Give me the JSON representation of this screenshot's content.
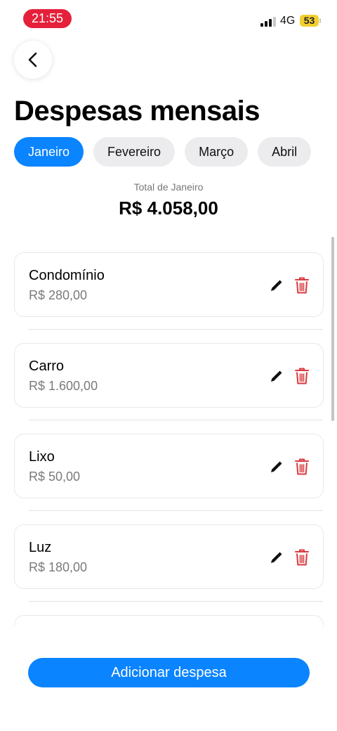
{
  "status_bar": {
    "time": "21:55",
    "network": "4G",
    "battery": "53",
    "battery_color": "#f2cf2e",
    "time_pill_color": "#e5203a"
  },
  "header": {
    "back_icon": "chevron-left-icon",
    "title": "Despesas mensais"
  },
  "months": [
    {
      "label": "Janeiro",
      "active": true
    },
    {
      "label": "Fevereiro",
      "active": false
    },
    {
      "label": "Março",
      "active": false
    },
    {
      "label": "Abril",
      "active": false
    }
  ],
  "summary": {
    "label": "Total de Janeiro",
    "value": "R$ 4.058,00"
  },
  "expenses": [
    {
      "name": "Condomínio",
      "amount": "R$ 280,00"
    },
    {
      "name": "Carro",
      "amount": "R$ 1.600,00"
    },
    {
      "name": "Lixo",
      "amount": "R$ 50,00"
    },
    {
      "name": "Luz",
      "amount": "R$ 180,00"
    },
    {
      "name": "",
      "amount": ""
    }
  ],
  "icons": {
    "edit": "pencil-icon",
    "delete": "trash-icon"
  },
  "colors": {
    "accent": "#0a84ff",
    "delete": "#d9393f"
  },
  "actions": {
    "add_label": "Adicionar despesa"
  }
}
